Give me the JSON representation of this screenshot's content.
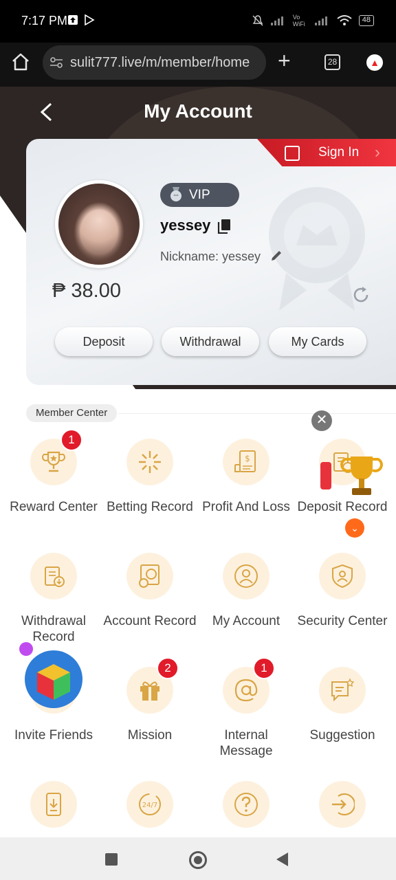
{
  "status_bar": {
    "time": "7:17 PM",
    "battery": "48",
    "network_label": "Vo WiFi"
  },
  "browser": {
    "url": "sulit777.live/m/member/home",
    "tabs_count": "28"
  },
  "header": {
    "title": "My Account"
  },
  "account": {
    "sign_in_label": "Sign In",
    "vip_label": "VIP",
    "username": "yessey",
    "nickname": "Nickname: yessey",
    "balance": "₱ 38.00"
  },
  "actions": {
    "deposit": "Deposit",
    "withdrawal": "Withdrawal",
    "my_cards": "My Cards"
  },
  "member_center": {
    "tag": "Member Center",
    "items": [
      {
        "label": "Reward Center",
        "icon": "trophy-icon",
        "badge": "1"
      },
      {
        "label": "Betting Record",
        "icon": "star-burst-icon",
        "badge": ""
      },
      {
        "label": "Profit And Loss",
        "icon": "money-document-icon",
        "badge": ""
      },
      {
        "label": "Deposit Record",
        "icon": "deposit-record-icon",
        "badge": ""
      },
      {
        "label": "Withdrawal Record",
        "icon": "withdrawal-record-icon",
        "badge": ""
      },
      {
        "label": "Account Record",
        "icon": "account-record-icon",
        "badge": ""
      },
      {
        "label": "My Account",
        "icon": "user-icon",
        "badge": ""
      },
      {
        "label": "Security Center",
        "icon": "shield-user-icon",
        "badge": ""
      },
      {
        "label": "Invite Friends",
        "icon": "invite-icon",
        "badge": "!"
      },
      {
        "label": "Mission",
        "icon": "gift-icon",
        "badge": "2"
      },
      {
        "label": "Internal Message",
        "icon": "at-sign-icon",
        "badge": "1"
      },
      {
        "label": "Suggestion",
        "icon": "suggestion-icon",
        "badge": ""
      }
    ]
  },
  "colors": {
    "accent_red": "#e11b2a",
    "icon_gold": "#d9a545",
    "icon_bg": "#fdf1de"
  }
}
